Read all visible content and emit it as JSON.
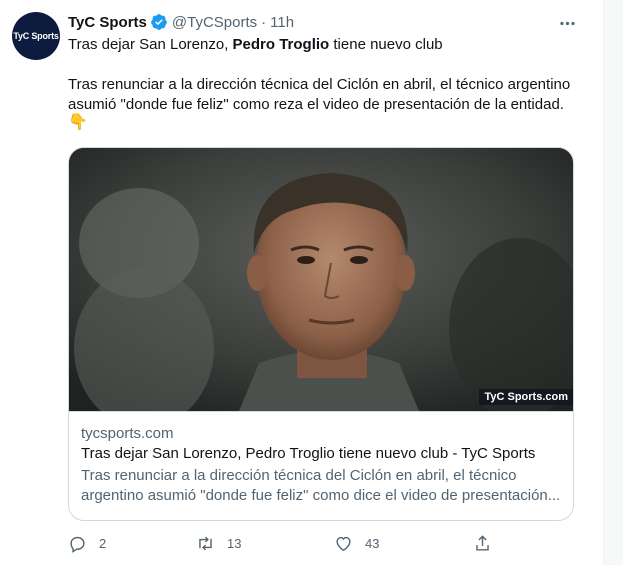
{
  "tweet": {
    "author": {
      "name": "TyC Sports",
      "handle": "@TyCSports",
      "separator": "·",
      "time": "11h",
      "avatar_text": "TyC Sports"
    },
    "text": {
      "line1_pre": "Tras dejar San Lorenzo, ",
      "line1_bold": "Pedro Troglio",
      "line1_post": " tiene nuevo club",
      "line2": "Tras renunciar a la dirección técnica del Ciclón en abril, el técnico argentino",
      "line3": "asumió \"donde fue feliz\" como reza el video de presentación de la entidad.",
      "emoji": "👇"
    },
    "card": {
      "watermark": "TyC Sports.com",
      "domain": "tycsports.com",
      "title": "Tras dejar San Lorenzo, Pedro Troglio tiene nuevo club - TyC Sports",
      "desc_line1": "Tras renunciar a la dirección técnica del Ciclón en abril, el técnico",
      "desc_line2": "argentino asumió \"donde fue feliz\" como dice el video de presentación..."
    },
    "actions": {
      "replies": "2",
      "retweets": "13",
      "likes": "43"
    }
  },
  "icons": {
    "verified": "verified-badge-icon",
    "more": "more-options-icon",
    "reply": "reply-icon",
    "retweet": "retweet-icon",
    "like": "heart-icon",
    "share": "share-icon"
  },
  "colors": {
    "accent": "#1d9bf0",
    "secondary_text": "#536471",
    "primary_text": "#0f1419",
    "border": "#cfd9de",
    "avatar_bg": "#0d1b3e"
  }
}
